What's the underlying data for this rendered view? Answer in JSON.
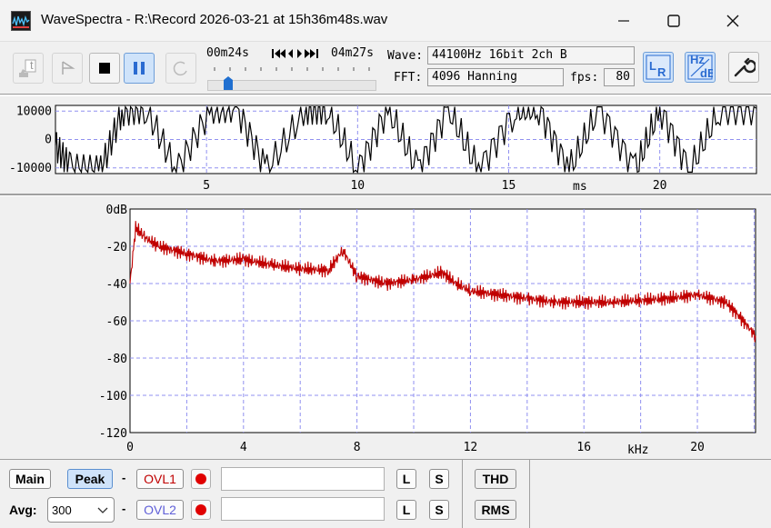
{
  "window": {
    "title": "WaveSpectra - R:\\Record 2026-03-21 at 15h36m48s.wav",
    "controls": {
      "minimize": "minimize-icon",
      "maximize": "maximize-icon",
      "close": "close-icon"
    }
  },
  "toolbar": {
    "position_time": "00m24s",
    "total_time": "04m27s",
    "seek_progress": 0.09,
    "wave_label": "Wave:",
    "wave_value": "44100Hz 16bit 2ch B",
    "fft_label": "FFT:",
    "fft_value": "4096 Hanning",
    "fps_label": "fps:",
    "fps_value": "80",
    "icons": [
      "open-file-icon",
      "play-icon",
      "stop-icon",
      "pause-icon",
      "repeat-icon",
      "lr-channel-icon",
      "hz-db-scale-icon",
      "settings-wrench-icon"
    ],
    "accent": "#2a6bd1"
  },
  "waveform": {
    "y_ticks": [
      "10000",
      "0",
      "-10000"
    ],
    "x_ticks": [
      "5",
      "10",
      "15",
      "20"
    ],
    "x_unit": "ms",
    "color": "#000000"
  },
  "spectrum": {
    "y_ticks": [
      "0dB",
      "-20",
      "-40",
      "-60",
      "-80",
      "-100",
      "-120"
    ],
    "x_ticks": [
      "0",
      "4",
      "8",
      "12",
      "16",
      "20"
    ],
    "x_unit": "kHz",
    "color": "#c00000",
    "grid_color": "#9090f0"
  },
  "chart_data": [
    {
      "type": "line",
      "ylim": [
        -12000,
        12000
      ],
      "xlim": [
        0,
        23.2
      ],
      "x_unit": "ms",
      "grid": true,
      "series": [
        {
          "x": [
            0,
            0.5,
            1.5,
            2.2,
            3,
            4,
            5.1,
            6,
            7,
            8.3,
            9,
            10,
            11,
            12,
            13,
            14,
            15.2,
            16,
            17,
            18,
            19.2,
            20,
            21,
            22,
            23.2
          ],
          "y": [
            -2000,
            -10000,
            -11000,
            10000,
            11000,
            -11000,
            10000,
            11000,
            -11000,
            11000,
            11000,
            -11000,
            11000,
            -11000,
            11000,
            -11000,
            10000,
            11000,
            -11000,
            11000,
            -11000,
            11000,
            -11000,
            11000,
            11000
          ]
        }
      ]
    },
    {
      "type": "line",
      "ylim": [
        -120,
        0
      ],
      "xlim": [
        0,
        22.05
      ],
      "x_unit": "kHz",
      "grid": true,
      "series": [
        {
          "x": [
            0,
            0.2,
            0.5,
            1,
            2,
            3,
            4,
            5,
            6,
            7,
            7.5,
            8,
            9,
            10,
            11,
            11.5,
            12,
            13,
            14,
            15,
            16,
            17,
            18,
            19,
            20,
            21,
            21.5,
            22.05
          ],
          "y": [
            -40,
            -10,
            -15,
            -20,
            -24,
            -28,
            -27,
            -30,
            -32,
            -33,
            -22,
            -36,
            -40,
            -38,
            -34,
            -40,
            -44,
            -46,
            -48,
            -50,
            -50,
            -50,
            -49,
            -48,
            -46,
            -50,
            -58,
            -68
          ]
        }
      ]
    }
  ],
  "bottom": {
    "main_label": "Main",
    "peak_label": "Peak",
    "dash1": "-",
    "dash2": "-",
    "ovl1_label": "OVL1",
    "ovl2_label": "OVL2",
    "avg_label": "Avg:",
    "avg_value": "300",
    "l_label": "L",
    "s_label": "S",
    "thd_label": "THD",
    "rms_label": "RMS"
  }
}
